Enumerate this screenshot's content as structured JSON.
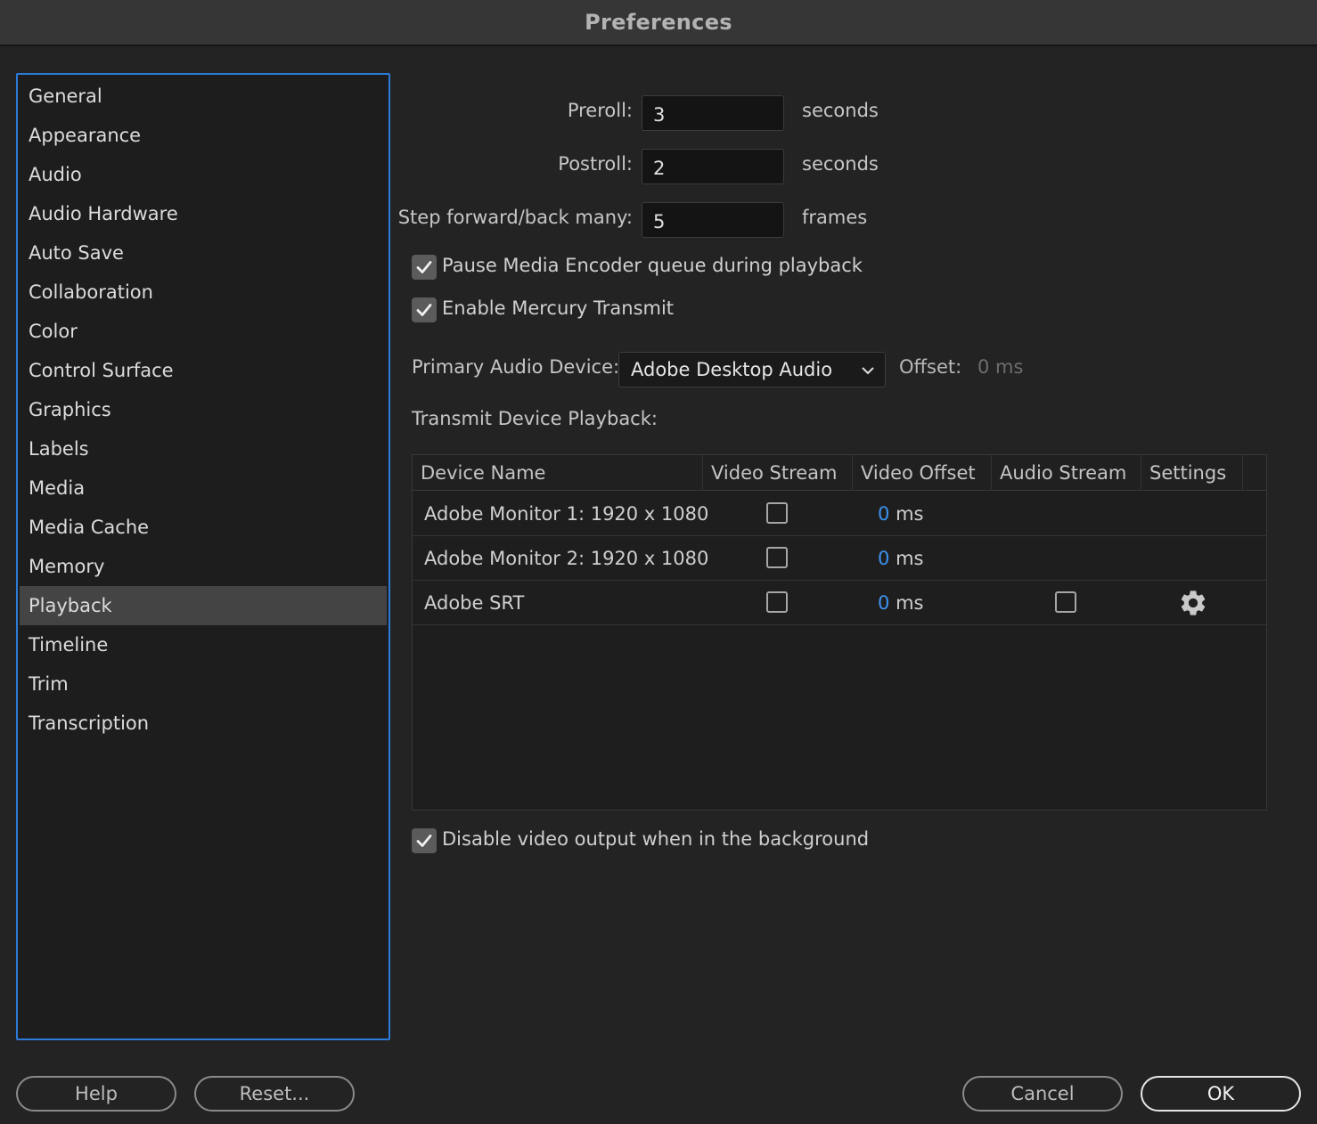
{
  "window": {
    "title": "Preferences"
  },
  "sidebar": {
    "items": [
      {
        "label": "General"
      },
      {
        "label": "Appearance"
      },
      {
        "label": "Audio"
      },
      {
        "label": "Audio Hardware"
      },
      {
        "label": "Auto Save"
      },
      {
        "label": "Collaboration"
      },
      {
        "label": "Color"
      },
      {
        "label": "Control Surface"
      },
      {
        "label": "Graphics"
      },
      {
        "label": "Labels"
      },
      {
        "label": "Media"
      },
      {
        "label": "Media Cache"
      },
      {
        "label": "Memory"
      },
      {
        "label": "Playback",
        "selected": true
      },
      {
        "label": "Timeline"
      },
      {
        "label": "Trim"
      },
      {
        "label": "Transcription"
      }
    ]
  },
  "playback": {
    "preroll": {
      "label": "Preroll:",
      "value": "3",
      "unit": "seconds"
    },
    "postroll": {
      "label": "Postroll:",
      "value": "2",
      "unit": "seconds"
    },
    "step": {
      "label": "Step forward/back many:",
      "value": "5",
      "unit": "frames"
    },
    "pause_encoder": {
      "label": "Pause Media Encoder queue during playback",
      "checked": true
    },
    "mercury_transmit": {
      "label": "Enable Mercury Transmit",
      "checked": true
    },
    "audio_device": {
      "label": "Primary Audio Device:",
      "value": "Adobe Desktop Audio",
      "offset_label": "Offset:",
      "offset_value": "0 ms"
    },
    "transmit_label": "Transmit Device Playback:",
    "disable_background": {
      "label": "Disable video output when in the background",
      "checked": true
    }
  },
  "transmit_table": {
    "columns": [
      "Device Name",
      "Video Stream",
      "Video Offset",
      "Audio Stream",
      "Settings"
    ],
    "rows": [
      {
        "device": "Adobe Monitor 1: 1920 x 1080",
        "video_stream": false,
        "offset": "0",
        "unit": "ms",
        "audio_stream": null,
        "settings": false
      },
      {
        "device": "Adobe Monitor 2: 1920 x 1080",
        "video_stream": false,
        "offset": "0",
        "unit": "ms",
        "audio_stream": null,
        "settings": false
      },
      {
        "device": "Adobe SRT",
        "video_stream": false,
        "offset": "0",
        "unit": "ms",
        "audio_stream": false,
        "settings": true
      }
    ]
  },
  "footer": {
    "help": "Help",
    "reset": "Reset...",
    "cancel": "Cancel",
    "ok": "OK"
  },
  "colors": {
    "accent": "#2d7bd8",
    "link_blue": "#3d93ee",
    "background": "#232323"
  }
}
